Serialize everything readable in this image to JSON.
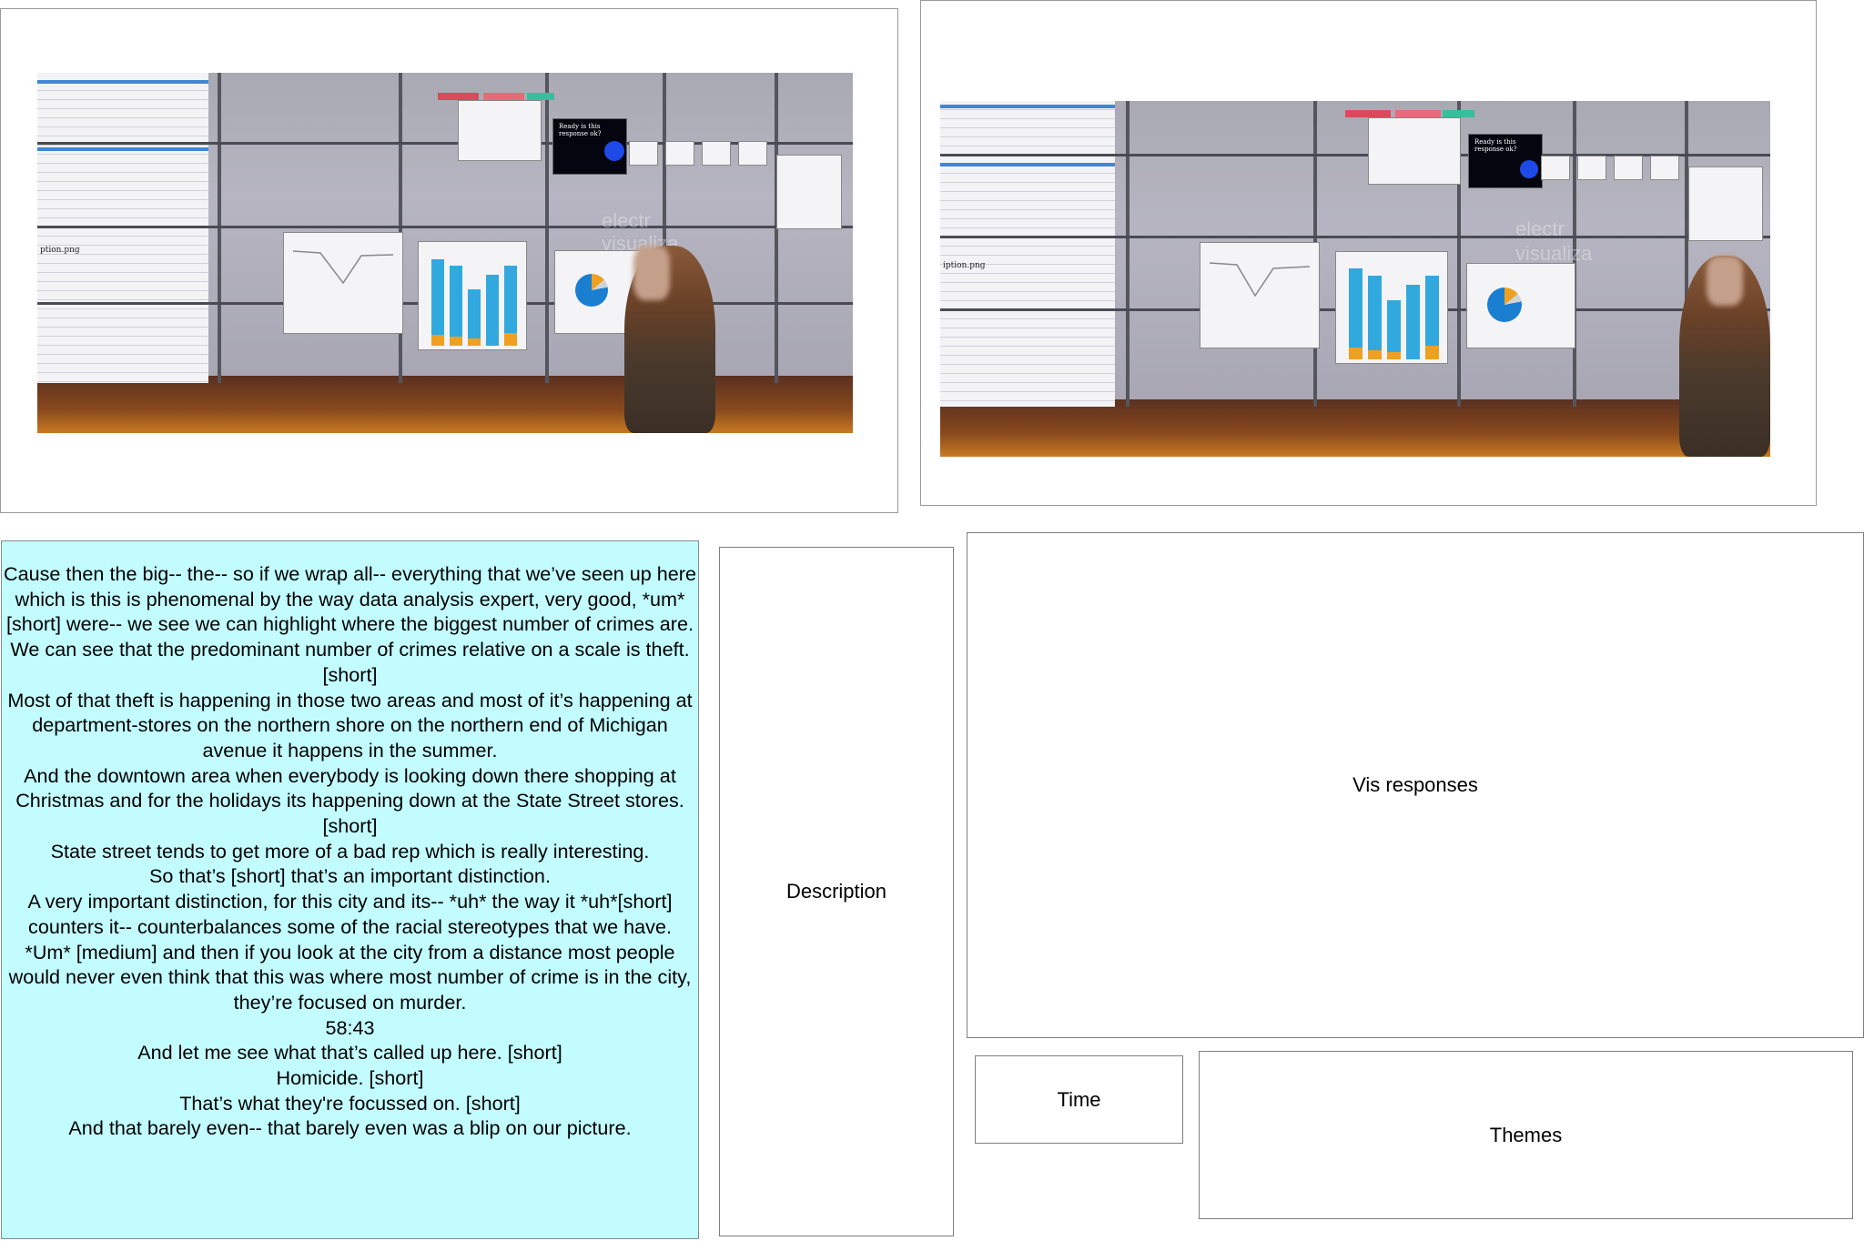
{
  "screens": {
    "doc_caption": "ption.png",
    "doc_caption_2": "iption.png",
    "popup_text": "Ready is this response ok?",
    "logo_text_1": "electr",
    "logo_text_2": "visualiza"
  },
  "transcript": {
    "lines": [
      "Cause then the big-- the-- so if we wrap all-- everything that we’ve seen up here which is this is phenomenal by the way data analysis expert, very good, *um* [short] were-- we see we can highlight where the biggest number of crimes are.",
      "We can see that the predominant number of crimes relative on a scale is theft. [short]",
      "Most of that theft is happening in those two areas and most of it’s happening at department-stores on the northern shore on the northern end of Michigan avenue it happens in the summer.",
      "And the downtown area when everybody is looking down there shopping at Christmas and for the holidays its happening down at the State Street stores. [short]",
      "State street tends to get more of a bad rep which is really interesting.",
      "So that’s [short] that’s an important distinction.",
      "A very important distinction, for this city and its-- *uh* the way it *uh*[short] counters it-- counterbalances some of the racial stereotypes that we have.",
      "*Um* [medium] and then if you look at the city from a distance most people would never even think that this was where most number of crime is in the city, they’re focused on murder.",
      "58:43",
      "And let me see what that’s called up here. [short]",
      "Homicide. [short]",
      "That’s what they're focussed on. [short]",
      "And that barely even-- that barely even was a blip on our picture."
    ]
  },
  "boxes": {
    "description": "Description",
    "vis_responses": "Vis responses",
    "time": "Time",
    "themes": "Themes"
  },
  "colors": {
    "transcript_bg": "#c2fcff",
    "bar_blue": "#32a9de",
    "bar_orange": "#f0a020",
    "doc_header_blue": "#3e86d6"
  }
}
